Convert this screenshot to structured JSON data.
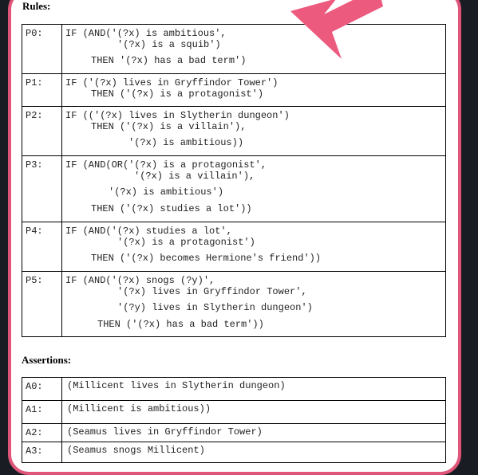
{
  "rules_heading": "Rules:",
  "assertions_heading": "Assertions:",
  "rules": [
    {
      "id": "P0:",
      "lines": [
        "IF (AND('(?x) is ambitious',",
        "'(?x) is a squib')",
        "THEN '(?x) has a bad term')"
      ]
    },
    {
      "id": "P1:",
      "lines": [
        "IF ('(?x) lives in Gryffindor Tower')",
        "THEN ('(?x) is a protagonist')"
      ]
    },
    {
      "id": "P2:",
      "lines": [
        "IF (('(?x) lives in Slytherin dungeon')",
        "THEN ('(?x) is a villain'),",
        "'(?x) is ambitious))"
      ]
    },
    {
      "id": "P3:",
      "lines": [
        "IF (AND(OR('(?x) is a protagonist',",
        "'(?x) is a villain'),",
        "'(?x) is ambitious')",
        "THEN ('(?x) studies a lot'))"
      ]
    },
    {
      "id": "P4:",
      "lines": [
        "IF (AND('(?x) studies a lot',",
        "'(?x) is a protagonist')",
        "THEN ('(?x) becomes Hermione's friend'))"
      ]
    },
    {
      "id": "P5:",
      "lines": [
        "IF (AND('(?x) snogs (?y)',",
        "'(?x) lives in Gryffindor Tower',",
        "'(?y) lives in Slytherin dungeon')",
        "THEN ('(?x) has a bad term'))"
      ]
    }
  ],
  "assertions": [
    {
      "id": "A0:",
      "text": "(Millicent lives in Slytherin dungeon)"
    },
    {
      "id": "A1:",
      "text": "(Millicent is ambitious))"
    },
    {
      "id": "A2:",
      "text": "(Seamus lives in Gryffindor Tower)"
    },
    {
      "id": "A3:",
      "text": "(Seamus snogs Millicent)"
    }
  ],
  "colors": {
    "frame": "#e0567a",
    "arrow": "#ec5a7e",
    "background": "#1a1c24"
  },
  "icons": {
    "annotation": "pointer-arrow-icon"
  }
}
